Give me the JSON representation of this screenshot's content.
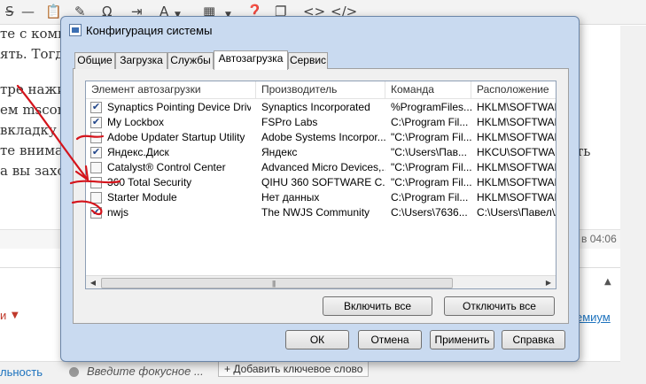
{
  "background": {
    "article_lines": [
      "те с компь",
      "ять. Тогда",
      "тре нажим",
      "ем msconf",
      "вкладку \"",
      "те внима",
      "а вы захоч"
    ],
    "right_text": "ть",
    "timestamp": "в 04:06",
    "premium_link": "емиум",
    "left_fragment": "и",
    "bottom_tab": "льность",
    "focus_placeholder": "Введите фокусное ...",
    "add_keyword_button": "+ Добавить ключевое слово",
    "toolbar_icons": [
      "strikethrough-icon",
      "paste-text-icon",
      "eraser-icon",
      "special-char-icon",
      "text-color-icon",
      "table-icon",
      "help-icon",
      "code-icon",
      "code-tag-icon"
    ]
  },
  "dialog": {
    "title": "Конфигурация системы",
    "tabs": [
      {
        "label": "Общие",
        "active": false
      },
      {
        "label": "Загрузка",
        "active": false
      },
      {
        "label": "Службы",
        "active": false
      },
      {
        "label": "Автозагрузка",
        "active": true
      },
      {
        "label": "Сервис",
        "active": false
      }
    ],
    "columns": [
      "Элемент автозагрузки",
      "Производитель",
      "Команда",
      "Расположение"
    ],
    "rows": [
      {
        "checked": true,
        "name": "Synaptics Pointing Device Driver",
        "vendor": "Synaptics Incorporated",
        "command": "%ProgramFiles...",
        "location": "HKLM\\SOFTWARE\\"
      },
      {
        "checked": true,
        "name": "My Lockbox",
        "vendor": "FSPro Labs",
        "command": "C:\\Program Fil...",
        "location": "HKLM\\SOFTWARE\\"
      },
      {
        "checked": false,
        "name": "Adobe Updater Startup Utility",
        "vendor": "Adobe Systems Incorpor...",
        "command": "\"C:\\Program Fil...",
        "location": "HKLM\\SOFTWARE\\"
      },
      {
        "checked": true,
        "name": "Яндекс.Диск",
        "vendor": "Яндекс",
        "command": "\"C:\\Users\\Пав...",
        "location": "HKCU\\SOFTWARE\\"
      },
      {
        "checked": false,
        "name": "Catalyst® Control Center",
        "vendor": "Advanced Micro Devices,...",
        "command": "\"C:\\Program Fil...",
        "location": "HKLM\\SOFTWARE\\"
      },
      {
        "checked": false,
        "name": "360 Total Security",
        "vendor": "QIHU 360 SOFTWARE C...",
        "command": "\"C:\\Program Fil...",
        "location": "HKLM\\SOFTWARE\\"
      },
      {
        "checked": false,
        "name": "Starter Module",
        "vendor": "Нет данных",
        "command": "C:\\Program Fil...",
        "location": "HKLM\\SOFTWARE\\"
      },
      {
        "checked": true,
        "name": "nwjs",
        "vendor": "The NWJS Community",
        "command": "C:\\Users\\7636...",
        "location": "C:\\Users\\Павел\\Ap"
      }
    ],
    "enable_all": "Включить все",
    "disable_all": "Отключить все",
    "ok": "ОК",
    "cancel": "Отмена",
    "apply": "Применить",
    "help": "Справка"
  },
  "colors": {
    "dialog_frame": "#c9daf0",
    "annotation": "#d4141c"
  }
}
